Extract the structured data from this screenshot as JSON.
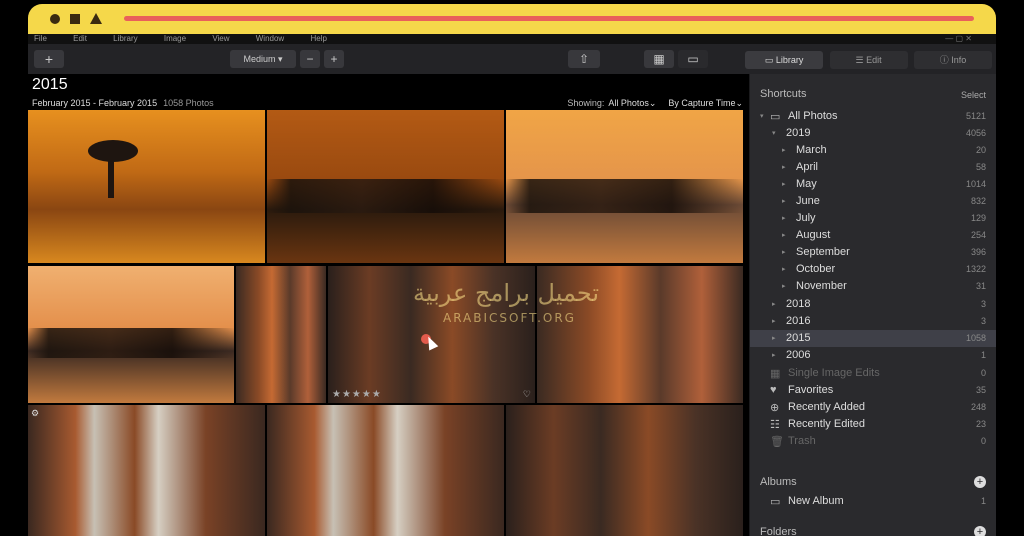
{
  "menu": [
    "File",
    "Edit",
    "Library",
    "Image",
    "View",
    "Window",
    "Help"
  ],
  "window_controls": "— ▢ ✕",
  "toolbar": {
    "add_label": "+",
    "zoom_value": "Medium",
    "zoom_out": "−",
    "zoom_in": "+",
    "share_icon": "⇧",
    "grid_icon": "▦",
    "single_icon": "▭"
  },
  "tabs": [
    {
      "label": "Library",
      "icon": "library-icon"
    },
    {
      "label": "Edit",
      "icon": "sliders-icon"
    },
    {
      "label": "Info",
      "icon": "info-icon"
    }
  ],
  "content": {
    "title": "2015",
    "date_range": "February 2015 - February 2015",
    "count": "1058 Photos",
    "showing_label": "Showing:",
    "showing_value": "All Photos",
    "sort_value": "By Capture Time"
  },
  "photo_overlay": {
    "stars": "★★★★★",
    "heart": "♡",
    "adjust": "⚙"
  },
  "watermark": {
    "arabic": "تحميل برامج عربية",
    "latin": "ARABICSOFT.ORG"
  },
  "sidebar": {
    "header": "Shortcuts",
    "select": "Select",
    "items": [
      {
        "label": "All Photos",
        "count": "5121"
      },
      {
        "label": "2019",
        "count": "4056"
      },
      {
        "label": "March",
        "count": "20"
      },
      {
        "label": "April",
        "count": "58"
      },
      {
        "label": "May",
        "count": "1014"
      },
      {
        "label": "June",
        "count": "832"
      },
      {
        "label": "July",
        "count": "129"
      },
      {
        "label": "August",
        "count": "254"
      },
      {
        "label": "September",
        "count": "396"
      },
      {
        "label": "October",
        "count": "1322"
      },
      {
        "label": "November",
        "count": "31"
      },
      {
        "label": "2018",
        "count": "3"
      },
      {
        "label": "2016",
        "count": "3"
      },
      {
        "label": "2015",
        "count": "1058"
      },
      {
        "label": "2006",
        "count": "1"
      },
      {
        "label": "Single Image Edits",
        "count": "0"
      },
      {
        "label": "Favorites",
        "count": "35"
      },
      {
        "label": "Recently Added",
        "count": "248"
      },
      {
        "label": "Recently Edited",
        "count": "23"
      },
      {
        "label": "Trash",
        "count": "0"
      }
    ],
    "albums_header": "Albums",
    "new_album": "New Album",
    "new_album_count": "1",
    "folders_header": "Folders"
  }
}
